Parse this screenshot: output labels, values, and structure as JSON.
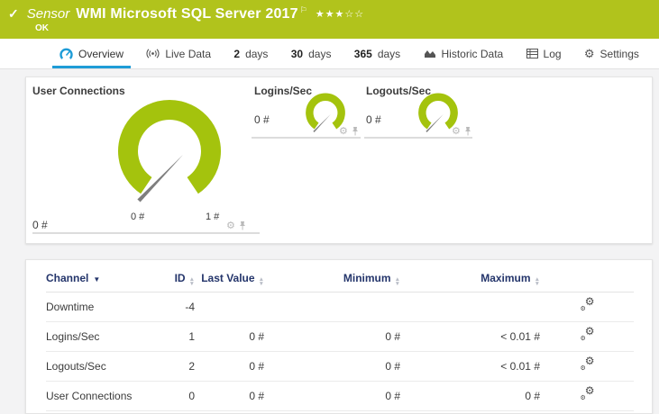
{
  "colors": {
    "header_green": "#b1c31c",
    "gauge_green": "#a4c30d",
    "accent_blue": "#1e9cd7",
    "table_header_navy": "#24356b"
  },
  "header": {
    "kind": "Sensor",
    "title": "WMI Microsoft SQL Server 2017",
    "status": "OK",
    "rating": {
      "filled": 3,
      "total": 5,
      "filled_glyphs": "★★★",
      "empty_glyphs": "☆☆"
    }
  },
  "tabs": {
    "overview": {
      "label": "Overview"
    },
    "live_data": {
      "label": "Live Data"
    },
    "d2": {
      "number": "2",
      "label": "days"
    },
    "d30": {
      "number": "30",
      "label": "days"
    },
    "d365": {
      "number": "365",
      "label": "days"
    },
    "historic": {
      "label": "Historic Data"
    },
    "log": {
      "label": "Log"
    },
    "settings": {
      "label": "Settings"
    }
  },
  "gauges": {
    "user_connections": {
      "title": "User Connections",
      "value": "0 #",
      "scale_min": "0 #",
      "scale_max": "1 #"
    },
    "logins_sec": {
      "title": "Logins/Sec",
      "value": "0 #"
    },
    "logouts_sec": {
      "title": "Logouts/Sec",
      "value": "0 #"
    }
  },
  "table": {
    "columns": {
      "channel": "Channel",
      "id": "ID",
      "last_value": "Last Value",
      "minimum": "Minimum",
      "maximum": "Maximum"
    },
    "rows": [
      {
        "channel": "Downtime",
        "id": "-4",
        "last_value": "",
        "minimum": "",
        "maximum": ""
      },
      {
        "channel": "Logins/Sec",
        "id": "1",
        "last_value": "0 #",
        "minimum": "0 #",
        "maximum": "< 0.01 #"
      },
      {
        "channel": "Logouts/Sec",
        "id": "2",
        "last_value": "0 #",
        "minimum": "0 #",
        "maximum": "< 0.01 #"
      },
      {
        "channel": "User Connections",
        "id": "0",
        "last_value": "0 #",
        "minimum": "0 #",
        "maximum": "0 #"
      }
    ]
  }
}
